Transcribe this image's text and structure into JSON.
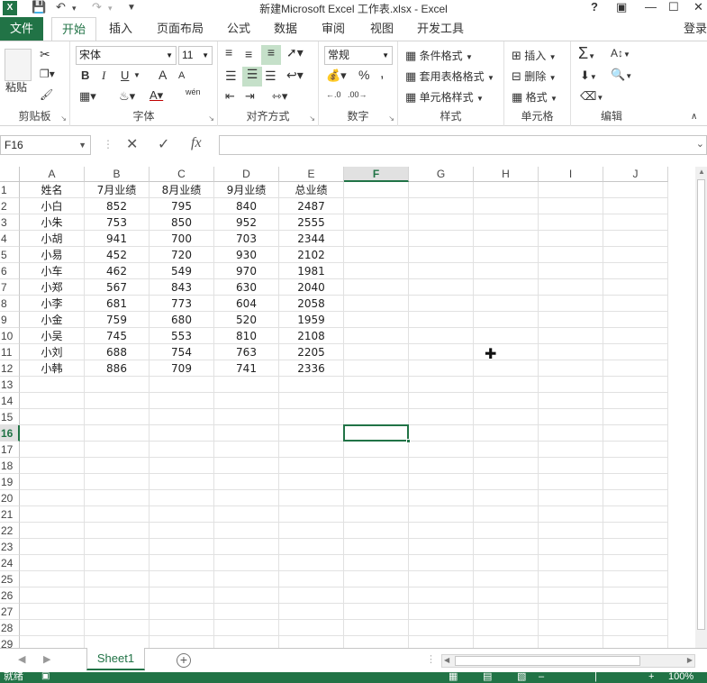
{
  "app": {
    "window_title": "新建Microsoft Excel 工作表.xlsx - Excel",
    "login": "登录",
    "help": "?",
    "colors": {
      "accent": "#217346",
      "highlight": "#c5e0c9"
    }
  },
  "tabs": {
    "file": "文件",
    "items": [
      "开始",
      "插入",
      "页面布局",
      "公式",
      "数据",
      "审阅",
      "视图",
      "开发工具"
    ],
    "active": "开始"
  },
  "ribbon": {
    "clipboard": {
      "label": "剪贴板",
      "paste": "粘贴"
    },
    "font": {
      "label": "字体",
      "name": "宋体",
      "size": "11",
      "bold": "B",
      "italic": "I",
      "underline": "U",
      "grow": "A",
      "shrink": "A",
      "phonetic": "wén"
    },
    "alignment": {
      "label": "对齐方式"
    },
    "number": {
      "label": "数字",
      "format": "常规",
      "percent": "%",
      "comma": ","
    },
    "styles": {
      "label": "样式",
      "conditional": "条件格式",
      "table": "套用表格格式",
      "cell_styles": "单元格样式"
    },
    "cells": {
      "label": "单元格",
      "insert": "插入",
      "delete": "删除",
      "format": "格式"
    },
    "editing": {
      "label": "编辑"
    }
  },
  "formula_bar": {
    "name_box": "F16",
    "fx": "fx",
    "value": ""
  },
  "columns": [
    "A",
    "B",
    "C",
    "D",
    "E",
    "F",
    "G",
    "H",
    "I",
    "J"
  ],
  "selected": {
    "column": "F",
    "row": "16"
  },
  "rows": [
    "1",
    "2",
    "3",
    "4",
    "5",
    "6",
    "7",
    "8",
    "9",
    "10",
    "11",
    "12",
    "13",
    "14",
    "15",
    "16",
    "17",
    "18",
    "19",
    "20",
    "21",
    "22",
    "23",
    "24",
    "25",
    "26",
    "27",
    "28",
    "29"
  ],
  "table": {
    "headers": [
      "姓名",
      "7月业绩",
      "8月业绩",
      "9月业绩",
      "总业绩"
    ],
    "data": [
      [
        "小白",
        "852",
        "795",
        "840",
        "2487"
      ],
      [
        "小朱",
        "753",
        "850",
        "952",
        "2555"
      ],
      [
        "小胡",
        "941",
        "700",
        "703",
        "2344"
      ],
      [
        "小易",
        "452",
        "720",
        "930",
        "2102"
      ],
      [
        "小车",
        "462",
        "549",
        "970",
        "1981"
      ],
      [
        "小郑",
        "567",
        "843",
        "630",
        "2040"
      ],
      [
        "小李",
        "681",
        "773",
        "604",
        "2058"
      ],
      [
        "小金",
        "759",
        "680",
        "520",
        "1959"
      ],
      [
        "小吴",
        "745",
        "553",
        "810",
        "2108"
      ],
      [
        "小刘",
        "688",
        "754",
        "763",
        "2205"
      ],
      [
        "小韩",
        "886",
        "709",
        "741",
        "2336"
      ]
    ]
  },
  "sheets": {
    "tabs": [
      "Sheet1"
    ],
    "active": "Sheet1"
  },
  "status": {
    "left": "就绪",
    "zoom": "100%"
  }
}
